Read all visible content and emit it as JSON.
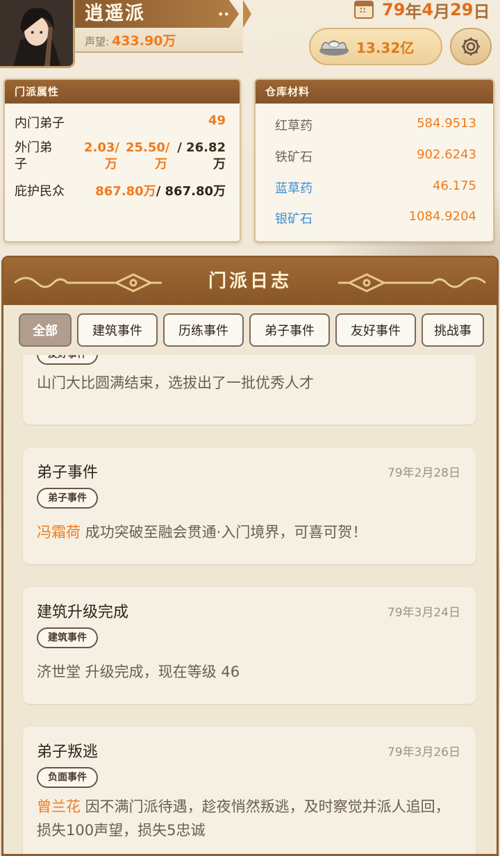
{
  "header": {
    "sect_name": "逍遥派",
    "dots": "••",
    "prestige_label": "声望:",
    "prestige_value": "433.90万",
    "date": {
      "year": "79",
      "year_unit": "年",
      "month": "4",
      "month_unit": "月",
      "day": "29",
      "day_unit": "日"
    },
    "silver_value": "13.32亿",
    "icons": {
      "avatar": "disciple-portrait",
      "calendar": "calendar-icon",
      "silver": "silver-ingot-icon",
      "settings": "gear-icon"
    }
  },
  "attributes": {
    "title": "门派属性",
    "inner_label": "内门弟子",
    "inner_value": "49",
    "outer_label": "外门弟子",
    "outer_v1": "2.03/万",
    "outer_v2": "25.50/万",
    "outer_v3": "/ 26.82万",
    "protect_label": "庇护民众",
    "protect_value": "867.80万",
    "protect_total": "/ 867.80万"
  },
  "materials": {
    "title": "仓库材料",
    "items": [
      {
        "name": "红草药",
        "value": "584.9513"
      },
      {
        "name": "铁矿石",
        "value": "902.6243"
      },
      {
        "name": "蓝草药",
        "value": "46.175"
      },
      {
        "name": "银矿石",
        "value": "1084.9204"
      }
    ]
  },
  "journal": {
    "title": "门派日志",
    "tabs": [
      "全部",
      "建筑事件",
      "历练事件",
      "弟子事件",
      "友好事件",
      "挑战事"
    ],
    "entries": [
      {
        "badge": "友好事件",
        "text": "山门大比圆满结束，选拔出了一批优秀人才"
      },
      {
        "title": "弟子事件",
        "date": "79年2月28日",
        "badge": "弟子事件",
        "name": "冯霜荷",
        "text": " 成功突破至融会贯通·入门境界，可喜可贺！"
      },
      {
        "title": "建筑升级完成",
        "date": "79年3月24日",
        "badge": "建筑事件",
        "text": "济世堂 升级完成，现在等级 46"
      },
      {
        "title": "弟子叛逃",
        "date": "79年3月26日",
        "badge": "负面事件",
        "name": "曾兰花",
        "text": " 因不满门派待遇，趁夜悄然叛逃，及时察觉并派人追回，损失100声望，损失5忠诚"
      }
    ]
  },
  "colors": {
    "accent": "#f07b1d",
    "brown": "#8c5d30",
    "blue": "#3c8fd8"
  }
}
